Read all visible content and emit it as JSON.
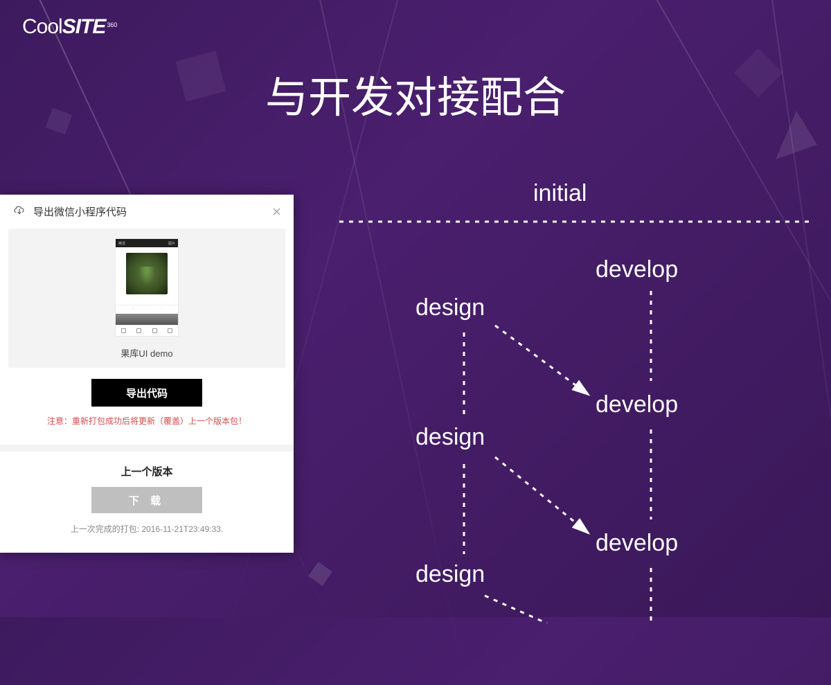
{
  "logo": {
    "part1": "Cool",
    "part2": "SITE",
    "part3": "360"
  },
  "title": "与开发对接配合",
  "diagram": {
    "initial": "initial",
    "design1": "design",
    "design2": "design",
    "design3": "design",
    "develop1": "develop",
    "develop2": "develop",
    "develop3": "develop"
  },
  "dialog": {
    "header": "导出微信小程序代码",
    "preview_label": "果库UI demo",
    "phone_tab_left": "精选",
    "phone_tab_right": "图片",
    "export_button": "导出代码",
    "warning": "注意：重新打包成功后将更新（覆盖）上一个版本包！",
    "previous_title": "上一个版本",
    "download_button": "下 载",
    "timestamp": "上一次完成的打包: 2016-11-21T23:49:33."
  }
}
